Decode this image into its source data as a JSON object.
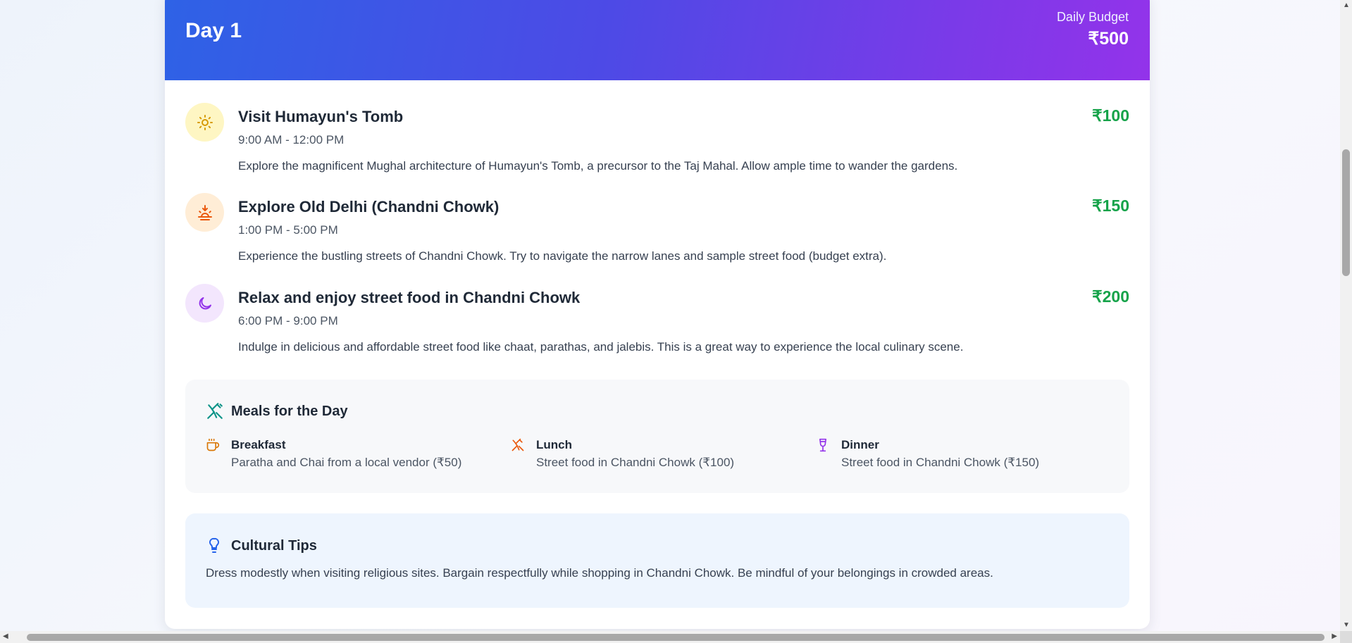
{
  "day": {
    "title": "Day 1",
    "budget_label": "Daily Budget",
    "budget_value": "₹500"
  },
  "activities": [
    {
      "title": "Visit Humayun's Tomb",
      "time": "9:00 AM - 12:00 PM",
      "description": "Explore the magnificent Mughal architecture of Humayun's Tomb, a precursor to the Taj Mahal. Allow ample time to wander the gardens.",
      "cost": "₹100",
      "icon": "sun-icon"
    },
    {
      "title": "Explore Old Delhi (Chandni Chowk)",
      "time": "1:00 PM - 5:00 PM",
      "description": "Experience the bustling streets of Chandni Chowk. Try to navigate the narrow lanes and sample street food (budget extra).",
      "cost": "₹150",
      "icon": "sunset-icon"
    },
    {
      "title": "Relax and enjoy street food in Chandni Chowk",
      "time": "6:00 PM - 9:00 PM",
      "description": "Indulge in delicious and affordable street food like chaat, parathas, and jalebis. This is a great way to experience the local culinary scene.",
      "cost": "₹200",
      "icon": "moon-icon"
    }
  ],
  "meals": {
    "title": "Meals for the Day",
    "items": [
      {
        "name": "Breakfast",
        "description": "Paratha and Chai from a local vendor (₹50)",
        "icon": "coffee-icon"
      },
      {
        "name": "Lunch",
        "description": "Street food in Chandni Chowk (₹100)",
        "icon": "utensils-icon"
      },
      {
        "name": "Dinner",
        "description": "Street food in Chandni Chowk (₹150)",
        "icon": "wine-icon"
      }
    ]
  },
  "tips": {
    "title": "Cultural Tips",
    "text": "Dress modestly when visiting religious sites. Bargain respectfully while shopping in Chandni Chowk. Be mindful of your belongings in crowded areas."
  },
  "colors": {
    "header_gradient_start": "#2e62e6",
    "header_gradient_end": "#9333ea",
    "cost": "#16a34a",
    "meals_bg": "#f7f8fa",
    "tips_bg": "#eef5fe"
  }
}
